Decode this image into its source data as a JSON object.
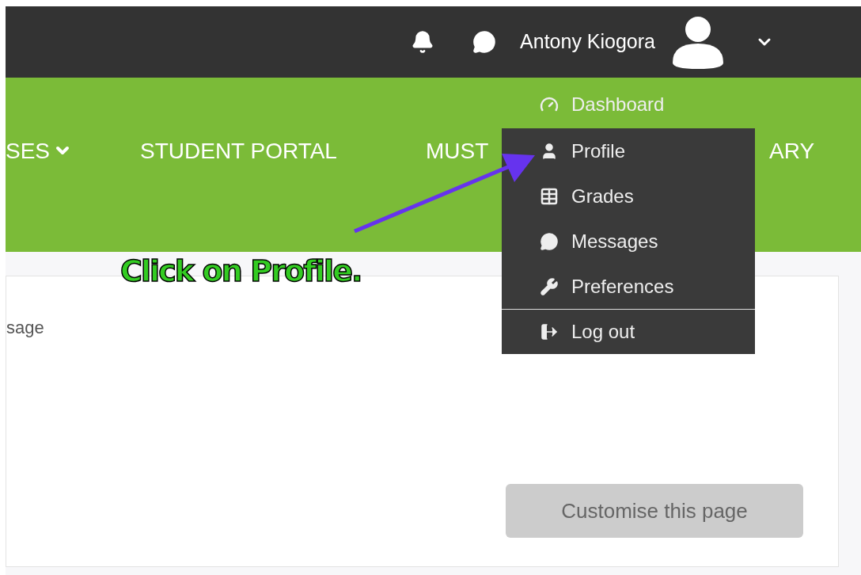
{
  "top_bar": {
    "user_name": "Antony Kiogora"
  },
  "nav": {
    "items": [
      {
        "label": "SES",
        "dropdown": true
      },
      {
        "label": "STUDENT PORTAL",
        "dropdown": false
      },
      {
        "label": "MUST",
        "dropdown": false
      },
      {
        "label": "ARY",
        "dropdown": false
      }
    ]
  },
  "user_menu": {
    "items": [
      {
        "kind": "dashboard",
        "label": "Dashboard",
        "separated": false
      },
      {
        "kind": "profile",
        "label": "Profile",
        "separated": false
      },
      {
        "kind": "grades",
        "label": "Grades",
        "separated": false
      },
      {
        "kind": "messages",
        "label": "Messages",
        "separated": false
      },
      {
        "kind": "preferences",
        "label": "Preferences",
        "separated": false
      },
      {
        "kind": "logout",
        "label": "Log out",
        "separated": true
      }
    ]
  },
  "annotation": {
    "text": "Click on Profile."
  },
  "card": {
    "text": "sage",
    "button": "Customise this page"
  }
}
